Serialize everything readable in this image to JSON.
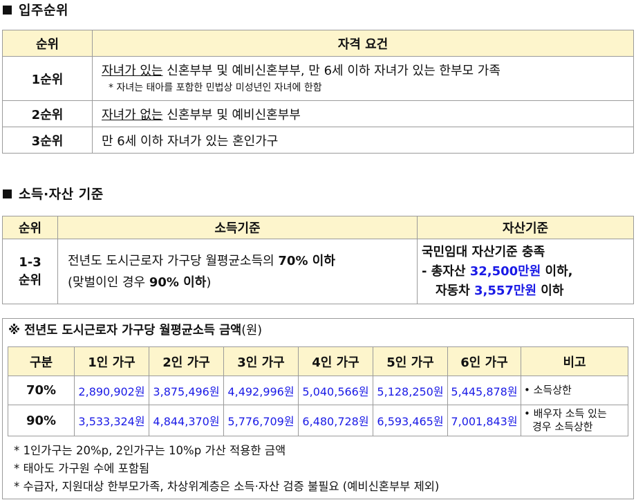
{
  "section1": {
    "title": "입주순위",
    "headers": [
      "순위",
      "자격 요건"
    ],
    "rows": [
      {
        "rank": "1순위",
        "u": "자녀가 있는",
        "text": " 신혼부부 및 예비신혼부부, 만 6세 이하 자녀가 있는 한부모 가족",
        "note": "* 자녀는 태아를 포함한 민법상 미성년인 자녀에 한함"
      },
      {
        "rank": "2순위",
        "u": "자녀가 없는",
        "text": " 신혼부부 및 예비신혼부부"
      },
      {
        "rank": "3순위",
        "text": "만 6세 이하 자녀가 있는 혼인가구"
      }
    ]
  },
  "section2": {
    "title": "소득·자산 기준",
    "headers": [
      "순위",
      "소득기준",
      "자산기준"
    ],
    "rank_line1": "1-3",
    "rank_line2": "순위",
    "income_line1_a": "전년도 도시근로자 가구당 월평균소득의 ",
    "income_line1_b": "70% 이하",
    "income_line2_a": "(맞벌이인 경우 ",
    "income_line2_b": "90% 이하",
    "income_line2_c": ")",
    "asset_line1": "국민임대 자산기준 충족",
    "asset_line2_a": "- 총자산 ",
    "asset_line2_b": "32,500만원",
    "asset_line2_c": " 이하,",
    "asset_line3_a": "자동차 ",
    "asset_line3_b": "3,557만원",
    "asset_line3_c": " 이하"
  },
  "section3": {
    "title_bold": "※ 전년도 도시근로자 가구당 월평균소득 금액",
    "title_unit": "(원)",
    "headers": [
      "구분",
      "1인 가구",
      "2인 가구",
      "3인 가구",
      "4인 가구",
      "5인 가구",
      "6인 가구",
      "비고"
    ],
    "rows": [
      {
        "label": "70%",
        "values": [
          "2,890,902원",
          "3,875,496원",
          "4,492,996원",
          "5,040,566원",
          "5,128,250원",
          "5,445,878원"
        ],
        "note1": "• 소득상한",
        "note2": ""
      },
      {
        "label": "90%",
        "values": [
          "3,533,324원",
          "4,844,370원",
          "5,776,709원",
          "6,480,728원",
          "6,593,465원",
          "7,001,843원"
        ],
        "note1": "• 배우자 소득 있는",
        "note2": "경우 소득상한"
      }
    ],
    "notes": [
      "* 1인가구는 20%p, 2인가구는 10%p 가산 적용한 금액",
      "* 태아도 가구원 수에 포함됨",
      "* 수급자, 지원대상 한부모가족, 차상위계층은 소득·자산 검증 불필요 (예비신혼부부 제외)"
    ]
  }
}
